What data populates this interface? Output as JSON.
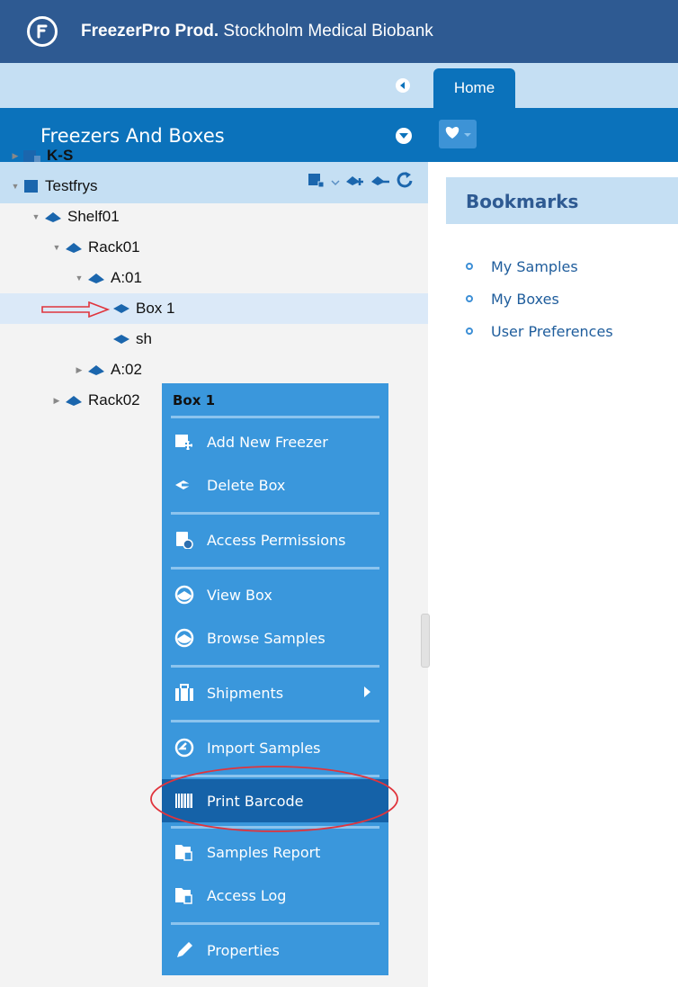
{
  "header": {
    "brand": "FreezerPro Prod.",
    "subtitle": "Stockholm Medical Biobank"
  },
  "left_panel": {
    "section_title": "Freezers And Boxes",
    "tree": [
      {
        "label": "K-S",
        "level": 0,
        "expander": "collapsed",
        "bold": true,
        "icon": "freezer-icon"
      },
      {
        "label": "Testfrys",
        "level": 0,
        "expander": "expanded",
        "bold": false,
        "icon": "freezer-icon"
      },
      {
        "label": "Shelf01",
        "level": 1,
        "expander": "expanded",
        "icon": "shelf-icon"
      },
      {
        "label": "Rack01",
        "level": 2,
        "expander": "expanded",
        "icon": "rack-icon"
      },
      {
        "label": "A:01",
        "level": 3,
        "expander": "expanded",
        "icon": "rack-icon"
      },
      {
        "label": "Box 1",
        "level": 4,
        "expander": "none",
        "selected": true,
        "icon": "box-icon"
      },
      {
        "label": "sh",
        "level": 4,
        "expander": "none",
        "icon": "box-icon"
      },
      {
        "label": "A:02",
        "level": 3,
        "expander": "collapsed",
        "icon": "rack-icon"
      },
      {
        "label": "Rack02",
        "level": 2,
        "expander": "collapsed",
        "icon": "rack-icon"
      }
    ]
  },
  "right_panel": {
    "tab_label": "Home",
    "bookmarks_title": "Bookmarks",
    "bookmarks": [
      "My Samples",
      "My Boxes",
      "User Preferences"
    ]
  },
  "context_menu": {
    "title": "Box 1",
    "items": [
      {
        "label": "Add New Freezer",
        "icon": "add-freezer-icon"
      },
      {
        "label": "Delete Box",
        "icon": "delete-box-icon"
      },
      {
        "label": "Access Permissions",
        "icon": "permissions-icon"
      },
      {
        "label": "View Box",
        "icon": "view-box-icon"
      },
      {
        "label": "Browse Samples",
        "icon": "browse-samples-icon"
      },
      {
        "label": "Shipments",
        "icon": "shipments-icon",
        "submenu": true
      },
      {
        "label": "Import Samples",
        "icon": "import-icon"
      },
      {
        "label": "Print Barcode",
        "icon": "barcode-icon",
        "active": true
      },
      {
        "label": "Samples Report",
        "icon": "report-icon"
      },
      {
        "label": "Access Log",
        "icon": "access-log-icon"
      },
      {
        "label": "Properties",
        "icon": "pencil-icon"
      }
    ]
  },
  "colors": {
    "header_bg": "#2e5a92",
    "panel_blue": "#0b72bb",
    "light_blue": "#c5dff3",
    "menu_bg": "#3a97dc",
    "menu_active": "#1562a8",
    "annotation_red": "#e0343c"
  }
}
